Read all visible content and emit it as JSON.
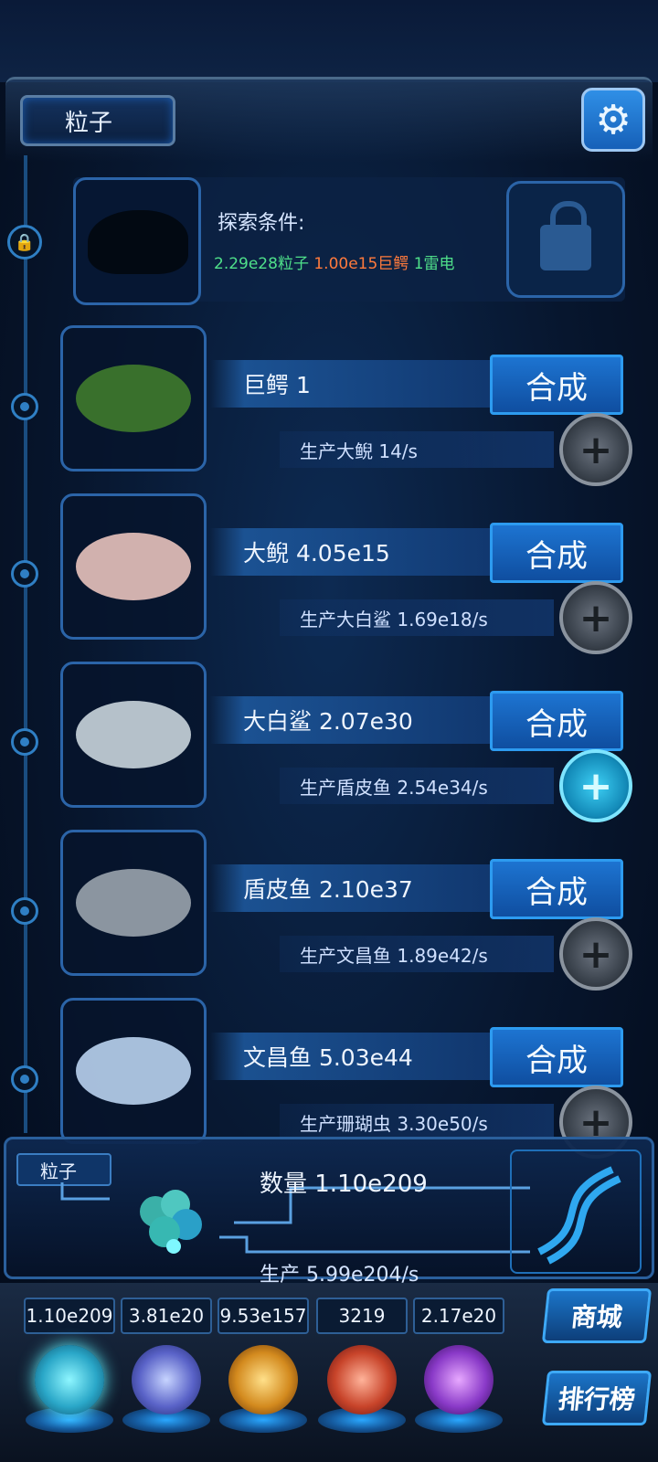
{
  "header": {
    "title": "粒子",
    "settings_icon": "gear-icon"
  },
  "locked": {
    "condition_title": "探索条件:",
    "req1": "2.29e28粒子",
    "req2": "1.00e15巨鳄",
    "req3": "1雷电",
    "lock_icon": "lock-icon"
  },
  "creatures": [
    {
      "name": "巨鳄 1",
      "produce": "生产大鲵 14/s",
      "merge_label": "合成",
      "plus_active": false
    },
    {
      "name": "大鲵 4.05e15",
      "produce": "生产大白鲨 1.69e18/s",
      "merge_label": "合成",
      "plus_active": false
    },
    {
      "name": "大白鲨 2.07e30",
      "produce": "生产盾皮鱼 2.54e34/s",
      "merge_label": "合成",
      "plus_active": true
    },
    {
      "name": "盾皮鱼 2.10e37",
      "produce": "生产文昌鱼 1.89e42/s",
      "merge_label": "合成",
      "plus_active": false
    },
    {
      "name": "文昌鱼 5.03e44",
      "produce": "生产珊瑚虫 3.30e50/s",
      "merge_label": "合成",
      "plus_active": false
    }
  ],
  "panel": {
    "tab": "粒子",
    "count": "数量 1.10e209",
    "production": "生产 5.99e204/s"
  },
  "resources": [
    "1.10e209",
    "3.81e20",
    "9.53e157",
    "3219",
    "2.17e20"
  ],
  "side_buttons": {
    "shop": "商城",
    "ranking": "排行榜"
  },
  "colors": {
    "accent_blue": "#1d74d1",
    "green_text": "#4fe08a",
    "orange_text": "#ff7a3c"
  }
}
